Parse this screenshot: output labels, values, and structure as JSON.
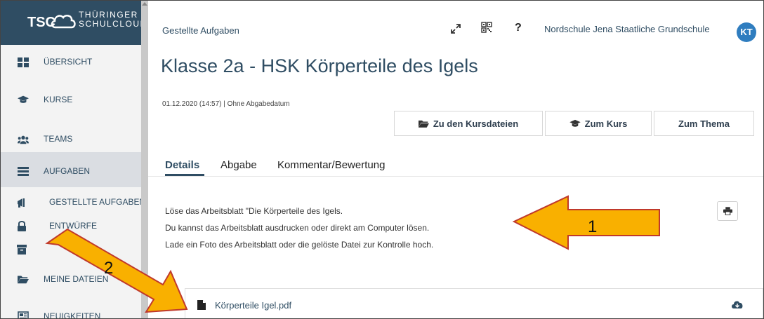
{
  "logo": {
    "short": "TSC",
    "line1": "THÜRINGER",
    "line2": "SCHULCLOUD"
  },
  "sidebar": {
    "items": [
      {
        "label": "ÜBERSICHT",
        "icon": "grid-icon"
      },
      {
        "label": "KURSE",
        "icon": "graduation-cap-icon"
      },
      {
        "label": "TEAMS",
        "icon": "users-icon"
      },
      {
        "label": "AUFGABEN",
        "icon": "tasks-icon"
      }
    ],
    "subitems": [
      {
        "label": "GESTELLTE AUFGABEN",
        "icon": "bullhorn-icon"
      },
      {
        "label": "ENTWÜRFE",
        "icon": "lock-icon"
      },
      {
        "label": "",
        "icon": "archive-icon"
      }
    ],
    "items2": [
      {
        "label": "MEINE DATEIEN",
        "icon": "folder-icon"
      },
      {
        "label": "NEUIGKEITEN",
        "icon": "newspaper-icon"
      }
    ]
  },
  "header": {
    "breadcrumb": "Gestellte Aufgaben",
    "school": "Nordschule Jena Staatliche Grundschule",
    "avatar": "KT",
    "help": "?"
  },
  "task": {
    "title": "Klasse 2a - HSK Körperteile des Igels",
    "meta": "01.12.2020 (14:57) | Ohne Abgabedatum",
    "buttons": {
      "files": "Zu den Kursdateien",
      "course": "Zum Kurs",
      "topic": "Zum Thema"
    },
    "tabs": [
      "Details",
      "Abgabe",
      "Kommentar/Bewertung"
    ],
    "description": [
      "Löse das Arbeitsblatt \"Die Körperteile des Igels.",
      "Du kannst das Arbeitsblatt ausdrucken oder direkt am Computer lösen.",
      "Lade ein Foto des Arbeitsblatt oder die gelöste Datei zur Kontrolle hoch."
    ],
    "file": {
      "name": "Körperteile Igel.pdf"
    }
  },
  "annotations": {
    "arrow1": "1",
    "arrow2": "2"
  },
  "colors": {
    "primary": "#2f4d63",
    "accent": "#2f7dbf",
    "arrow": "#f9b000",
    "sidebar_active": "#dadde2"
  }
}
